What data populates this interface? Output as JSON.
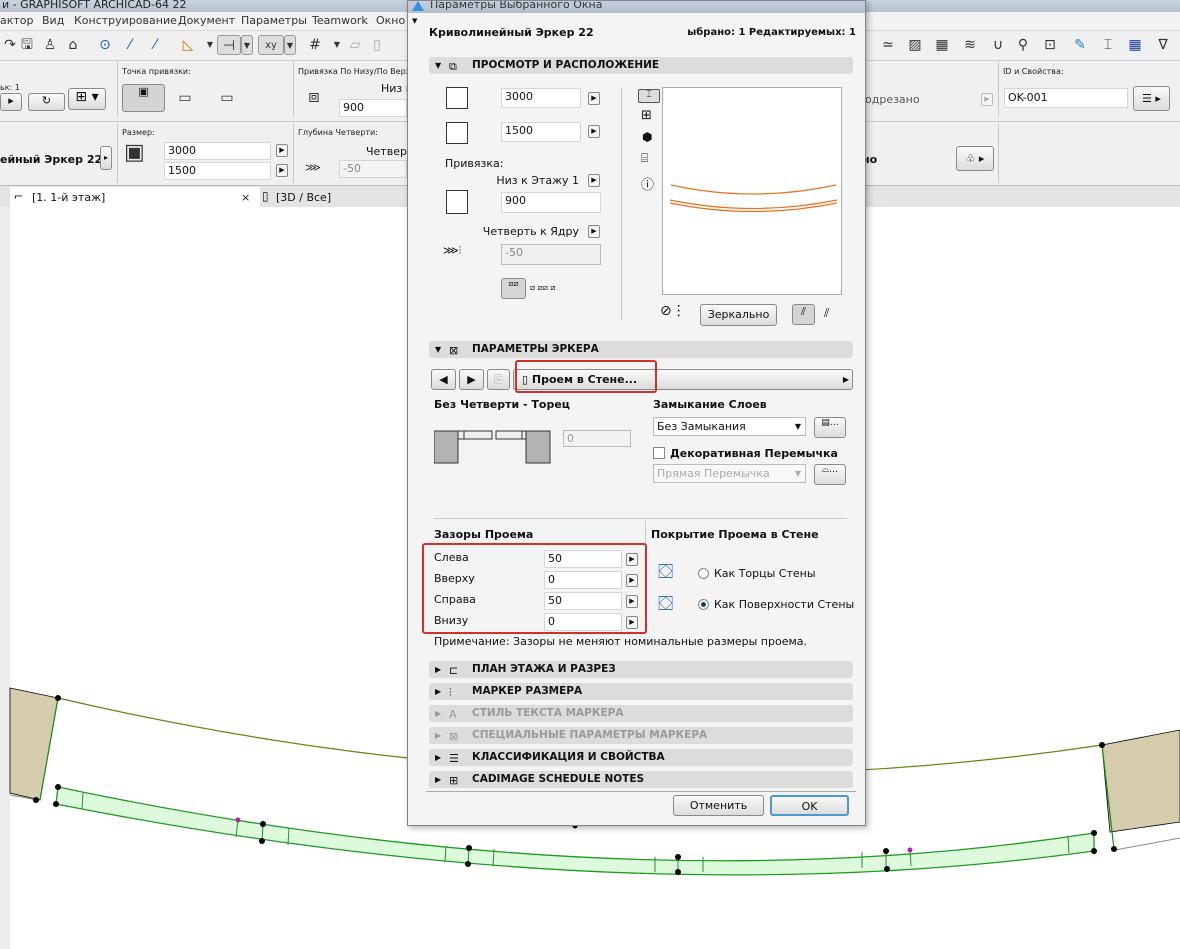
{
  "window": {
    "title": "и - GRAPHISOFT ARCHICAD-64 22"
  },
  "menu": [
    "актор",
    "Вид",
    "Конструирование",
    "Документ",
    "Параметры",
    "Teamwork",
    "Окно"
  ],
  "infobox": {
    "snap_label": "Точка привязки:",
    "layer_label": "ьк: 1",
    "anchor_label": "Привязка По Низу/По Верху:",
    "anchor_value": "Низ к",
    "sill_value": "900",
    "element_name": "ейный Эркер 22",
    "size_label": "Размер:",
    "width": "3000",
    "height": "1500",
    "reveal_label": "Глубина Четверти:",
    "reveal_mode": "Четверт",
    "reveal_value": "-50",
    "cut_label": "одрезано",
    "mirror_short": "но",
    "id_label": "ID и Свойства:",
    "id_value": "OK-001"
  },
  "tabs": [
    {
      "label": "[1. 1-й этаж]",
      "close": "×"
    },
    {
      "label": "[3D / Все]"
    }
  ],
  "dialog": {
    "title": "Параметры Выбранного Окна",
    "element_name": "Криволинейный Эркер 22",
    "selection_info": "ыбрано: 1 Редактируемых: 1",
    "sections": {
      "preview": "ПРОСМОТР И РАСПОЛОЖЕНИЕ",
      "params": "ПАРАМЕТРЫ ЭРКЕРА",
      "floorplan": "ПЛАН ЭТАЖА И РАЗРЕЗ",
      "dim_marker": "МАРКЕР РАЗМЕРА",
      "marker_text": "СТИЛЬ ТЕКСТА МАРКЕРА",
      "marker_special": "СПЕЦИАЛЬНЫЕ ПАРАМЕТРЫ МАРКЕРА",
      "classification": "КЛАССИФИКАЦИЯ И СВОЙСТВА",
      "cadimage": "CADIMAGE SCHEDULE NOTES"
    },
    "preview": {
      "width": "3000",
      "height": "1500",
      "anchor_label": "Привязка:",
      "anchor_mode": "Низ к Этажу 1",
      "sill": "900",
      "reveal_mode": "Четверть к Ядру",
      "reveal": "-50",
      "mirror_button": "Зеркально"
    },
    "params": {
      "page": "Проем в Стене...",
      "reveal_title": "Без Четверти - Торец",
      "reveal_value": "0",
      "layer_closure_label": "Замыкание Слоев",
      "layer_closure": "Без Замыкания",
      "decor_lintel_label": "Декоративная Перемычка",
      "decor_lintel_checked": false,
      "lintel_type": "Прямая Перемычка",
      "gaps_title": "Зазоры Проема",
      "gaps": [
        {
          "label": "Слева",
          "value": "50"
        },
        {
          "label": "Вверху",
          "value": "0"
        },
        {
          "label": "Справа",
          "value": "50"
        },
        {
          "label": "Внизу",
          "value": "0"
        }
      ],
      "cover_title": "Покрытие Проема в Стене",
      "cover_options": [
        "Как Торцы Стены",
        "Как Поверхности Стены"
      ],
      "cover_selected": 1,
      "note": "Примечание: Зазоры не меняют номинальные размеры проема."
    },
    "cancel": "Отменить",
    "ok": "OK"
  },
  "colors": {
    "highlight": "#d2302c",
    "window_fill": "#ddfadd",
    "wall_fill": "#d4ccac",
    "preview_line": "#e8731e"
  }
}
